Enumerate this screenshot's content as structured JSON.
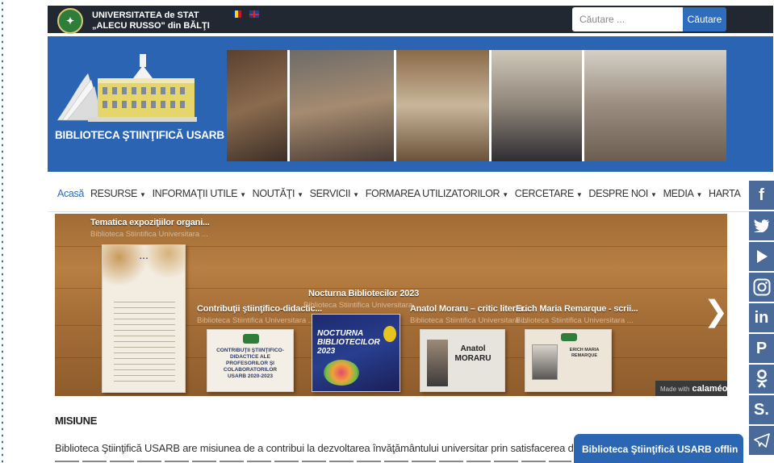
{
  "header": {
    "university_line1": "UNIVERSITATEA de STAT",
    "university_line2": "„ALECU RUSSO\" din BĂLŢI",
    "search": {
      "placeholder": "Căutare ...",
      "button_label": "Căutare"
    }
  },
  "banner": {
    "title": "BIBLIOTECA ŞTIINŢIFICĂ USARB"
  },
  "nav": {
    "items": [
      {
        "label": "Acasă",
        "dropdown": false,
        "active": true
      },
      {
        "label": "RESURSE",
        "dropdown": true
      },
      {
        "label": "INFORMAŢII UTILE",
        "dropdown": true
      },
      {
        "label": "NOUTĂŢI",
        "dropdown": true
      },
      {
        "label": "SERVICII",
        "dropdown": true
      },
      {
        "label": "FORMAREA UTILIZATORILOR",
        "dropdown": true
      },
      {
        "label": "CERCETARE",
        "dropdown": true
      },
      {
        "label": "DESPRE NOI",
        "dropdown": true
      },
      {
        "label": "MEDIA",
        "dropdown": true
      },
      {
        "label": "HARTA",
        "dropdown": false
      }
    ]
  },
  "carousel": {
    "items": [
      {
        "title": "Tematica expoziţiilor organi...",
        "subtitle": "Biblioteca Stiintifica Universitara ..."
      },
      {
        "title": "Contribuţii ştiinţifico-didactic...",
        "subtitle": "Biblioteca Stiintifica Universitara ..."
      },
      {
        "title": "Nocturna Bibliotecilor 2023",
        "subtitle": "Biblioteca Stiintifica Universitara ..."
      },
      {
        "title": "Anatol Moraru – critic literar...",
        "subtitle": "Biblioteca Stiintifica Universitara ..."
      },
      {
        "title": "Erich Maria Remarque - scrii...",
        "subtitle": "Biblioteca Stiintifica Universitara ..."
      }
    ],
    "book_texts": {
      "contributii": "CONTRIBUŢII ŞTIINŢIFICO-DIDACTICE ALE PROFESORILOR ŞI COLABORATORILOR USARB 2020-2023",
      "nocturna": "NOCTURNA BIBLIOTECILOR 2023",
      "moraru_line1": "Anatol",
      "moraru_line2": "MORARU",
      "remarque": "ERICH MARIA REMARQUE"
    },
    "made_with": "Made with",
    "calameo": "calaméo"
  },
  "content": {
    "heading": "MISIUNE",
    "paragraph": "Biblioteca Ştiinţifică USARB are misiunea de a contribui la dezvoltarea învăţământului universitar prin satisfacerea deplină a necesităţ"
  },
  "chat": {
    "label": "Biblioteca Ştiinţifică USARB offlin"
  },
  "social_icons": [
    "facebook-icon",
    "twitter-icon",
    "youtube-icon",
    "instagram-icon",
    "linkedin-icon",
    "pinterest-icon",
    "odnoklassniki-icon",
    "slideshare-icon",
    "telegram-icon"
  ],
  "colors": {
    "topbar": "#222831",
    "banner": "#2c64b4",
    "accent": "#2d6dbb",
    "social": "#4a6a99"
  }
}
